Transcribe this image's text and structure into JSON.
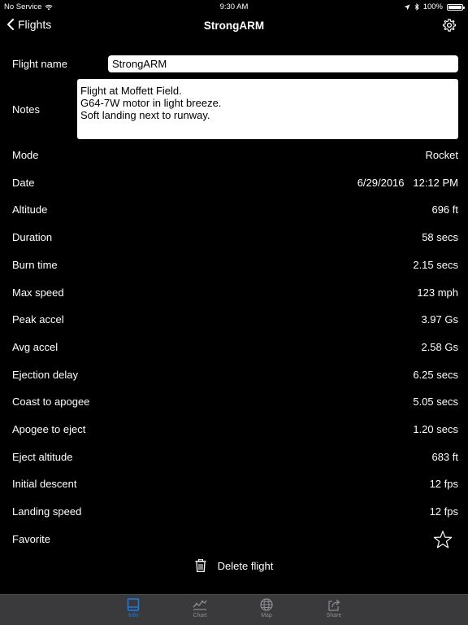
{
  "status_bar": {
    "carrier": "No Service",
    "time": "9:30 AM",
    "battery": "100%",
    "battery_level": 1.0
  },
  "nav": {
    "back_label": "Flights",
    "title": "StrongARM"
  },
  "form": {
    "flight_name_label": "Flight name",
    "flight_name_value": "StrongARM",
    "notes_label": "Notes",
    "notes_value": "Flight at Moffett Field.\nG64-7W motor in light breeze.\nSoft landing next to runway."
  },
  "details": [
    {
      "label": "Mode",
      "value": "Rocket"
    },
    {
      "label": "Date",
      "value": "6/29/2016   12:12 PM"
    },
    {
      "label": "Altitude",
      "value": "696 ft"
    },
    {
      "label": "Duration",
      "value": "58 secs"
    },
    {
      "label": "Burn time",
      "value": "2.15 secs"
    },
    {
      "label": "Max speed",
      "value": "123 mph"
    },
    {
      "label": "Peak accel",
      "value": "3.97 Gs"
    },
    {
      "label": "Avg accel",
      "value": "2.58 Gs"
    },
    {
      "label": "Ejection delay",
      "value": "6.25 secs"
    },
    {
      "label": "Coast to apogee",
      "value": "5.05 secs"
    },
    {
      "label": "Apogee to eject",
      "value": "1.20 secs"
    },
    {
      "label": "Eject altitude",
      "value": "683 ft"
    },
    {
      "label": "Initial descent",
      "value": "12 fps"
    },
    {
      "label": "Landing speed",
      "value": "12 fps"
    }
  ],
  "favorite": {
    "label": "Favorite",
    "icon": "star-outline-icon"
  },
  "delete": {
    "label": "Delete flight",
    "icon": "trash-icon"
  },
  "tabs": [
    {
      "label": "Info",
      "icon": "info-icon",
      "active": true
    },
    {
      "label": "Chart",
      "icon": "chart-icon",
      "active": false
    },
    {
      "label": "Map",
      "icon": "globe-icon",
      "active": false
    },
    {
      "label": "Share",
      "icon": "share-icon",
      "active": false
    }
  ],
  "colors": {
    "background": "#000000",
    "accent": "#1a7cf0",
    "tab_bar": "#3a3a3c",
    "tab_inactive": "#8e8e93"
  }
}
